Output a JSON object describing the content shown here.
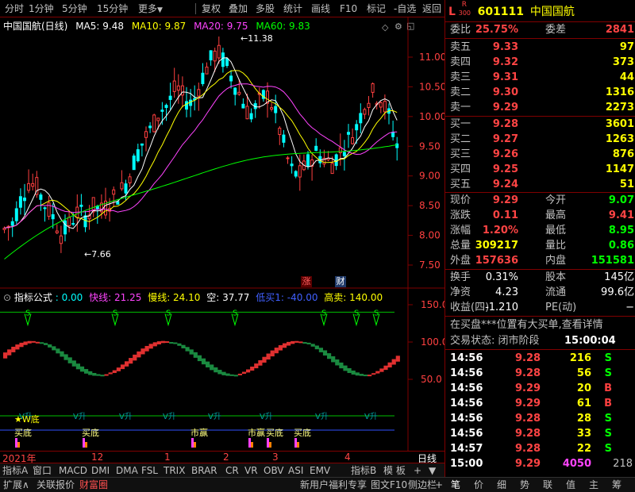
{
  "toolbar": {
    "items": [
      "分时",
      "1分钟",
      "5分钟",
      "15分钟",
      "更多",
      "复权",
      "叠加",
      "多股",
      "统计",
      "画线",
      "F10",
      "标记",
      "-自选",
      "返回"
    ]
  },
  "chart": {
    "title": "中国国航(日线)",
    "ma5": "MA5: 9.48",
    "ma10": "MA10: 9.87",
    "ma20": "MA20: 9.75",
    "ma60": "MA60: 9.83",
    "high_marker": "11.38",
    "low_marker": "7.66",
    "badge_zhang": "涨",
    "badge_cai": "财",
    "y_ticks": [
      "11.00",
      "10.50",
      "10.00",
      "9.50",
      "9.00",
      "8.50",
      "8.00",
      "7.50"
    ],
    "colors": {
      "up": "#ff4040",
      "down": "#00ffff",
      "ma5": "#ffffff",
      "ma10": "#ffff00",
      "ma20": "#ff44ff",
      "ma60": "#00ff00"
    }
  },
  "indicator": {
    "title": "指标公式",
    "v0": ": 0.00",
    "fast": "快线: 21.25",
    "slow": "慢线: 24.10",
    "empty": "空: 37.77",
    "lowbuy": "低买1: -40.00",
    "highsell": "高卖: 140.00",
    "y_ticks": [
      "150.0",
      "100.0",
      "50.0"
    ],
    "star_label": "★W底",
    "buy_labels": [
      "买底",
      "买底",
      "市赢",
      "市赢",
      "买底",
      "买底"
    ],
    "v_rise": "V升",
    "s_mark": "S"
  },
  "date_axis": {
    "labels": [
      "2021年",
      "12",
      "1",
      "2",
      "3",
      "4"
    ],
    "right_label": "日线"
  },
  "tabs": [
    "指标A",
    "窗口",
    "MACD",
    "DMI",
    "DMA",
    "FSL",
    "TRIX",
    "BRAR",
    "CR",
    "VR",
    "OBV",
    "ASI",
    "EMV",
    "指标B",
    "模 板",
    "+",
    "▼"
  ],
  "status": {
    "left": [
      "扩展∧",
      "关联报价",
      "财富圈"
    ],
    "right": [
      "新用户福利专享",
      "图文F10",
      "侧边栏",
      "+"
    ]
  },
  "quote": {
    "badge": "L",
    "badge_r": "R",
    "badge_num": "300",
    "code": "601111",
    "name": "中国国航",
    "weibi_label": "委比",
    "weibi": "25.75%",
    "weicha_label": "委差",
    "weicha": "2841",
    "asks": [
      {
        "label": "卖五",
        "price": "9.33",
        "vol": "97"
      },
      {
        "label": "卖四",
        "price": "9.32",
        "vol": "373"
      },
      {
        "label": "卖三",
        "price": "9.31",
        "vol": "44"
      },
      {
        "label": "卖二",
        "price": "9.30",
        "vol": "1316"
      },
      {
        "label": "卖一",
        "price": "9.29",
        "vol": "2273"
      }
    ],
    "bids": [
      {
        "label": "买一",
        "price": "9.28",
        "vol": "3601"
      },
      {
        "label": "买二",
        "price": "9.27",
        "vol": "1263"
      },
      {
        "label": "买三",
        "price": "9.26",
        "vol": "876"
      },
      {
        "label": "买四",
        "price": "9.25",
        "vol": "1147"
      },
      {
        "label": "买五",
        "price": "9.24",
        "vol": "51"
      }
    ],
    "stats": [
      {
        "l1": "现价",
        "v1": "9.29",
        "c1": "red",
        "l2": "今开",
        "v2": "9.07",
        "c2": "green"
      },
      {
        "l1": "涨跌",
        "v1": "0.11",
        "c1": "red",
        "l2": "最高",
        "v2": "9.41",
        "c2": "red"
      },
      {
        "l1": "涨幅",
        "v1": "1.20%",
        "c1": "red",
        "l2": "最低",
        "v2": "8.95",
        "c2": "green"
      },
      {
        "l1": "总量",
        "v1": "309217",
        "c1": "yellow",
        "l2": "量比",
        "v2": "0.86",
        "c2": "green"
      },
      {
        "l1": "外盘",
        "v1": "157636",
        "c1": "red",
        "l2": "内盘",
        "v2": "151581",
        "c2": "green"
      }
    ],
    "stats2": [
      {
        "l1": "换手",
        "v1": "0.31%",
        "l2": "股本",
        "v2": "145亿"
      },
      {
        "l1": "净资",
        "v1": "4.23",
        "l2": "流通",
        "v2": "99.6亿"
      },
      {
        "l1": "收益(四)",
        "v1": "-1.210",
        "l2": "PE(动)",
        "v2": "−"
      }
    ],
    "notice": "在买盘***位置有大买单,查看详情",
    "trade_state_label": "交易状态: 闭市阶段",
    "trade_state_time": "15:00:04",
    "ticks": [
      {
        "time": "14:56",
        "price": "9.28",
        "vol": "216",
        "dir": "S"
      },
      {
        "time": "14:56",
        "price": "9.28",
        "vol": "56",
        "dir": "S"
      },
      {
        "time": "14:56",
        "price": "9.29",
        "vol": "20",
        "dir": "B"
      },
      {
        "time": "14:56",
        "price": "9.29",
        "vol": "61",
        "dir": "B"
      },
      {
        "time": "14:56",
        "price": "9.28",
        "vol": "28",
        "dir": "S"
      },
      {
        "time": "14:56",
        "price": "9.28",
        "vol": "33",
        "dir": "S"
      },
      {
        "time": "14:57",
        "price": "9.28",
        "vol": "22",
        "dir": "S"
      },
      {
        "time": "15:00",
        "price": "9.29",
        "vol": "4050",
        "dir": "218"
      }
    ],
    "bottom_tabs": [
      "笔",
      "价",
      "细",
      "势",
      "联",
      "值",
      "主",
      "筹"
    ]
  }
}
